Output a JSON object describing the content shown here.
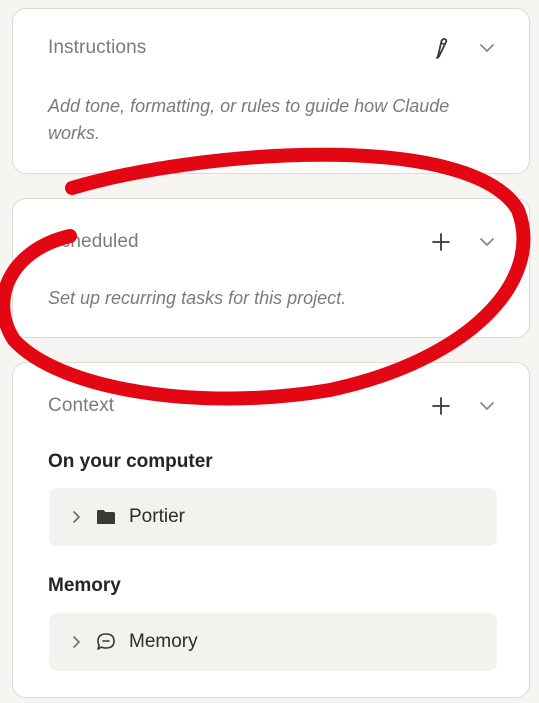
{
  "instructions": {
    "title": "Instructions",
    "edit_icon": "pencil-icon",
    "collapse_icon": "chevron-down-icon",
    "description": "Add tone, formatting, or rules to guide how Claude works."
  },
  "scheduled": {
    "title": "Scheduled",
    "add_icon": "plus-icon",
    "collapse_icon": "chevron-down-icon",
    "description": "Set up recurring tasks for this project."
  },
  "context": {
    "title": "Context",
    "add_icon": "plus-icon",
    "collapse_icon": "chevron-down-icon",
    "sections": [
      {
        "label": "On your computer",
        "items": [
          {
            "label": "Portier",
            "icon": "folder-icon"
          }
        ]
      },
      {
        "label": "Memory",
        "items": [
          {
            "label": "Memory",
            "icon": "memory-bubble-icon"
          }
        ]
      }
    ]
  },
  "colors": {
    "annotation_circle": "#e30613",
    "card_border": "#dcdad5",
    "muted_text": "#7c7b76"
  }
}
